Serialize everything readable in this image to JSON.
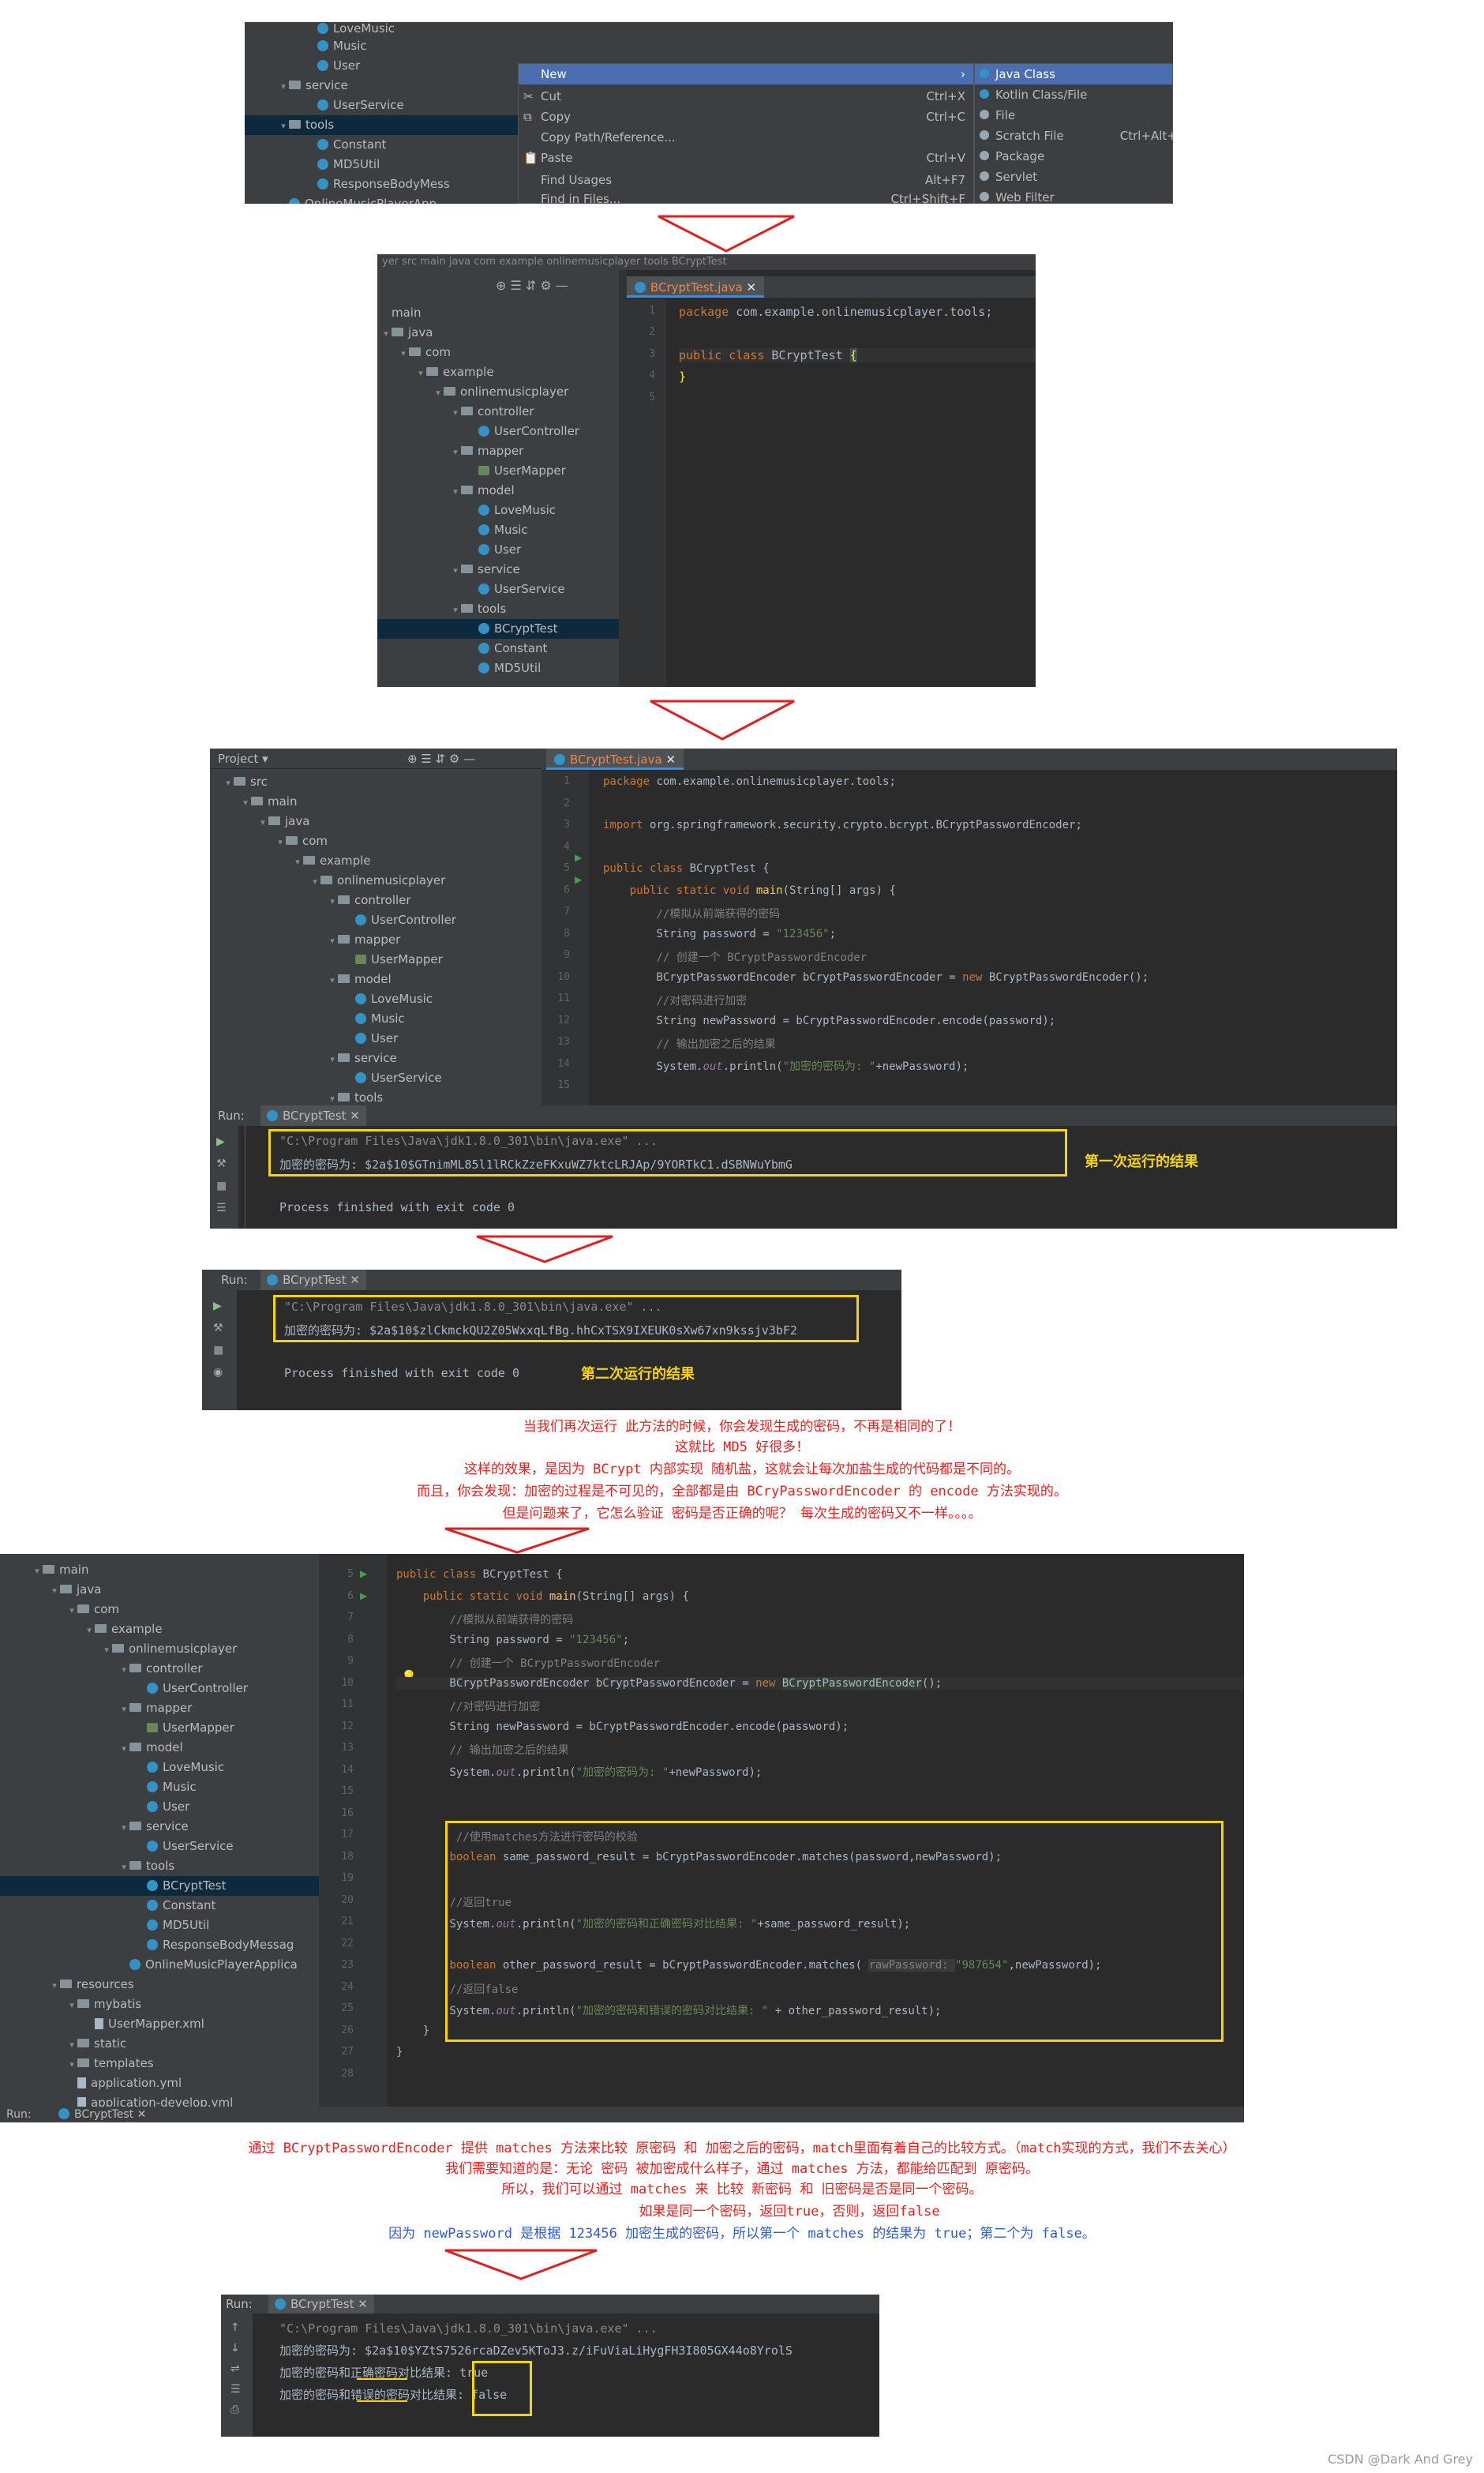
{
  "shot1": {
    "tree": [
      {
        "label": "LoveMusic",
        "type": "cls"
      },
      {
        "label": "Music",
        "type": "cls"
      },
      {
        "label": "User",
        "type": "cls"
      },
      {
        "label": "service",
        "type": "folder"
      },
      {
        "label": "UserService",
        "type": "cls"
      },
      {
        "label": "tools",
        "type": "folder"
      },
      {
        "label": "Constant",
        "type": "cls"
      },
      {
        "label": "MD5Util",
        "type": "cls"
      },
      {
        "label": "ResponseBodyMess",
        "type": "cls"
      },
      {
        "label": "OnlineMusicPlayerApp",
        "type": "cls"
      }
    ],
    "context_menu": [
      {
        "label": "New",
        "shortcut": "",
        "icon": ""
      },
      {
        "label": "Cut",
        "shortcut": "Ctrl+X",
        "icon": "scissors-icon"
      },
      {
        "label": "Copy",
        "shortcut": "Ctrl+C",
        "icon": "copy-icon"
      },
      {
        "label": "Copy Path/Reference...",
        "shortcut": "",
        "icon": ""
      },
      {
        "label": "Paste",
        "shortcut": "Ctrl+V",
        "icon": "paste-icon"
      },
      {
        "label": "Find Usages",
        "shortcut": "Alt+F7",
        "icon": ""
      },
      {
        "label": "Find in Files...",
        "shortcut": "Ctrl+Shift+F",
        "icon": ""
      }
    ],
    "submenu": [
      {
        "label": "Java Class",
        "shortcut": ""
      },
      {
        "label": "Kotlin Class/File",
        "shortcut": ""
      },
      {
        "label": "File",
        "shortcut": ""
      },
      {
        "label": "Scratch File",
        "shortcut": "Ctrl+Alt+Shift"
      },
      {
        "label": "Package",
        "shortcut": ""
      },
      {
        "label": "Servlet",
        "shortcut": ""
      },
      {
        "label": "Web Filter",
        "shortcut": ""
      }
    ]
  },
  "shot2": {
    "breadcrumb": "yer  src  main  java  com  example  onlinemusicplayer  tools  BCryptTest",
    "tab": "BCryptTest.java",
    "tree": [
      {
        "label": "main",
        "d": 0,
        "type": "none"
      },
      {
        "label": "java",
        "d": 0,
        "type": "folder"
      },
      {
        "label": "com",
        "d": 1,
        "type": "folder"
      },
      {
        "label": "example",
        "d": 2,
        "type": "folder"
      },
      {
        "label": "onlinemusicplayer",
        "d": 3,
        "type": "folder"
      },
      {
        "label": "controller",
        "d": 4,
        "type": "folder"
      },
      {
        "label": "UserController",
        "d": 5,
        "type": "cls"
      },
      {
        "label": "mapper",
        "d": 4,
        "type": "folder"
      },
      {
        "label": "UserMapper",
        "d": 5,
        "type": "map"
      },
      {
        "label": "model",
        "d": 4,
        "type": "folder"
      },
      {
        "label": "LoveMusic",
        "d": 5,
        "type": "cls"
      },
      {
        "label": "Music",
        "d": 5,
        "type": "cls"
      },
      {
        "label": "User",
        "d": 5,
        "type": "cls"
      },
      {
        "label": "service",
        "d": 4,
        "type": "folder"
      },
      {
        "label": "UserService",
        "d": 5,
        "type": "cls"
      },
      {
        "label": "tools",
        "d": 4,
        "type": "folder"
      },
      {
        "label": "BCryptTest",
        "d": 5,
        "type": "cls",
        "sel": true
      },
      {
        "label": "Constant",
        "d": 5,
        "type": "cls"
      },
      {
        "label": "MD5Util",
        "d": 5,
        "type": "cls"
      }
    ],
    "code": [
      "package com.example.onlinemusicplayer.tools;",
      "",
      "public class BCryptTest {",
      "}",
      ""
    ]
  },
  "shot3": {
    "project_label": "Project",
    "tab": "BCryptTest.java",
    "tree": [
      {
        "label": "src",
        "d": 0
      },
      {
        "label": "main",
        "d": 1
      },
      {
        "label": "java",
        "d": 2
      },
      {
        "label": "com",
        "d": 3
      },
      {
        "label": "example",
        "d": 4
      },
      {
        "label": "onlinemusicplayer",
        "d": 5
      },
      {
        "label": "controller",
        "d": 6
      },
      {
        "label": "UserController",
        "d": 7,
        "type": "cls"
      },
      {
        "label": "mapper",
        "d": 6
      },
      {
        "label": "UserMapper",
        "d": 7,
        "type": "map"
      },
      {
        "label": "model",
        "d": 6
      },
      {
        "label": "LoveMusic",
        "d": 7,
        "type": "cls"
      },
      {
        "label": "Music",
        "d": 7,
        "type": "cls"
      },
      {
        "label": "User",
        "d": 7,
        "type": "cls"
      },
      {
        "label": "service",
        "d": 6
      },
      {
        "label": "UserService",
        "d": 7,
        "type": "cls"
      },
      {
        "label": "tools",
        "d": 6
      }
    ],
    "run_label": "Run:",
    "run_tab": "BCryptTest",
    "console": [
      "\"C:\\Program Files\\Java\\jdk1.8.0_301\\bin\\java.exe\" ...",
      "加密的密码为: $2a$10$GTnimML85l1lRCkZzeFKxuWZ7ktcLRJAp/9YORTkC1.dSBNWuYbmG",
      "",
      "Process finished with exit code 0"
    ],
    "label": "第一次运行的结果"
  },
  "shot4": {
    "run_label": "Run:",
    "run_tab": "BCryptTest",
    "console": [
      "\"C:\\Program Files\\Java\\jdk1.8.0_301\\bin\\java.exe\" ...",
      "加密的密码为: $2a$10$zlCkmckQU2Z05WxxqLfBg.hhCxTSX9IXEUK0sXw67xn9kssjv3bF2",
      "",
      "Process finished with exit code 0"
    ],
    "label": "第二次运行的结果"
  },
  "note1": [
    "当我们再次运行 此方法的时候，你会发现生成的密码，不再是相同的了！",
    "这就比 MD5 好很多！",
    "这样的效果，是因为 BCrypt 内部实现 随机盐，这就会让每次加盐生成的代码都是不同的。",
    "而且，你会发现：加密的过程是不可见的，全部都是由 BCryPasswordEncoder 的 encode 方法实现的。",
    "但是问题来了，它怎么验证 密码是否正确的呢？ 每次生成的密码又不一样。。。。"
  ],
  "shot5": {
    "tree": [
      {
        "label": "main",
        "d": 0
      },
      {
        "label": "java",
        "d": 1
      },
      {
        "label": "com",
        "d": 2
      },
      {
        "label": "example",
        "d": 3
      },
      {
        "label": "onlinemusicplayer",
        "d": 4
      },
      {
        "label": "controller",
        "d": 5
      },
      {
        "label": "UserController",
        "d": 6,
        "type": "cls"
      },
      {
        "label": "mapper",
        "d": 5
      },
      {
        "label": "UserMapper",
        "d": 6,
        "type": "map"
      },
      {
        "label": "model",
        "d": 5
      },
      {
        "label": "LoveMusic",
        "d": 6,
        "type": "cls"
      },
      {
        "label": "Music",
        "d": 6,
        "type": "cls"
      },
      {
        "label": "User",
        "d": 6,
        "type": "cls"
      },
      {
        "label": "service",
        "d": 5
      },
      {
        "label": "UserService",
        "d": 6,
        "type": "cls"
      },
      {
        "label": "tools",
        "d": 5
      },
      {
        "label": "BCryptTest",
        "d": 6,
        "type": "cls",
        "sel": true
      },
      {
        "label": "Constant",
        "d": 6,
        "type": "cls"
      },
      {
        "label": "MD5Util",
        "d": 6,
        "type": "cls"
      },
      {
        "label": "ResponseBodyMessag",
        "d": 6,
        "type": "cls"
      },
      {
        "label": "OnlineMusicPlayerApplica",
        "d": 5,
        "type": "cls"
      },
      {
        "label": "resources",
        "d": 1
      },
      {
        "label": "mybatis",
        "d": 2
      },
      {
        "label": "UserMapper.xml",
        "d": 3,
        "type": "file"
      },
      {
        "label": "static",
        "d": 2
      },
      {
        "label": "templates",
        "d": 2
      },
      {
        "label": "application.yml",
        "d": 2,
        "type": "file"
      },
      {
        "label": "application-develop.yml",
        "d": 2,
        "type": "file"
      }
    ],
    "line_numbers": [
      "5",
      "6",
      "7",
      "8",
      "9",
      "10",
      "11",
      "12",
      "13",
      "14",
      "15",
      "16",
      "17",
      "18",
      "19",
      "20",
      "21",
      "22",
      "23",
      "24",
      "25",
      "26",
      "27",
      "28"
    ],
    "run_label": "Run:",
    "run_tab": "BCryptTest"
  },
  "note2_red": [
    "通过 BCryptPasswordEncoder 提供 matches 方法来比较 原密码 和 加密之后的密码，match里面有着自己的比较方式。（match实现的方式，我们不去关心）",
    "我们需要知道的是：无论 密码 被加密成什么样子，通过 matches 方法，都能给匹配到 原密码。",
    "所以，我们可以通过 matches 来 比较 新密码 和 旧密码是否是同一个密码。",
    "如果是同一个密码，返回true，否则，返回false"
  ],
  "note2_blue": "因为 newPassword 是根据 123456 加密生成的密码，所以第一个 matches 的结果为 true；第二个为 false。",
  "shot6": {
    "run_label": "Run:",
    "run_tab": "BCryptTest",
    "console": [
      "\"C:\\Program Files\\Java\\jdk1.8.0_301\\bin\\java.exe\" ...",
      "加密的密码为: $2a$10$YZtS7526rcaDZev5KToJ3.z/iFuViaLiHygFH3I805GX44o8YrolS",
      "加密的密码和正确密码对比结果: true",
      "加密的密码和错误的密码对比结果: false"
    ]
  },
  "watermark": "CSDN @Dark And Grey"
}
